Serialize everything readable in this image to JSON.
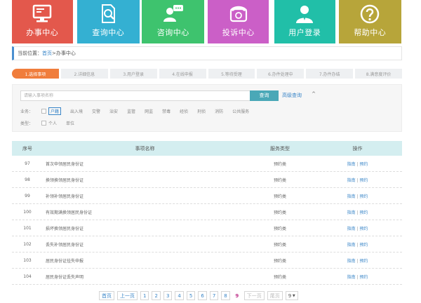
{
  "nav": [
    {
      "label": "办事中心",
      "icon": "monitor-icon"
    },
    {
      "label": "查询中心",
      "icon": "document-search-icon"
    },
    {
      "label": "咨询中心",
      "icon": "chat-user-icon"
    },
    {
      "label": "投诉中心",
      "icon": "telephone-icon"
    },
    {
      "label": "用户登录",
      "icon": "user-icon"
    },
    {
      "label": "帮助中心",
      "icon": "question-icon"
    }
  ],
  "breadcrumb": {
    "prefix": "当前位置：",
    "home": "首页",
    "sep": " > ",
    "current": "办事中心"
  },
  "steps": [
    "1.选择事项",
    "2.详细信息",
    "3.用户登录",
    "4.在线申报",
    "5.等待受理",
    "6.办件处理中",
    "7.办件办结",
    "8.满意度评价"
  ],
  "search": {
    "placeholder": "请输入事项名称",
    "button": "查询",
    "advanced": "高级查询",
    "caret": "^"
  },
  "filters": {
    "category_label": "业务：",
    "category_options": [
      "户籍",
      "出入境",
      "交警",
      "治安",
      "监管",
      "网监",
      "禁毒",
      "经侦",
      "刑侦",
      "消防",
      "公共服务"
    ],
    "type_label": "类型：",
    "type_options": [
      "个人",
      "单位"
    ]
  },
  "table": {
    "headers": [
      "序号",
      "事项名称",
      "服务类型",
      "操作"
    ],
    "rows": [
      {
        "no": "97",
        "name": "首次申领居民身份证",
        "type": "预约类",
        "guide": "指南",
        "book": "预约"
      },
      {
        "no": "98",
        "name": "换领换领居民身份证",
        "type": "预约类",
        "guide": "指南",
        "book": "预约"
      },
      {
        "no": "99",
        "name": "补领补领居民身份证",
        "type": "预约类",
        "guide": "指南",
        "book": "预约"
      },
      {
        "no": "100",
        "name": "有效期满换领居民身份证",
        "type": "预约类",
        "guide": "指南",
        "book": "预约"
      },
      {
        "no": "101",
        "name": "损坏换领居民身份证",
        "type": "预约类",
        "guide": "指南",
        "book": "预约"
      },
      {
        "no": "102",
        "name": "丢失补领居民身份证",
        "type": "预约类",
        "guide": "指南",
        "book": "预约"
      },
      {
        "no": "103",
        "name": "居民身份证挂失申报",
        "type": "预约类",
        "guide": "指南",
        "book": "预约"
      },
      {
        "no": "104",
        "name": "居民身份证丢失声明",
        "type": "预约类",
        "guide": "指南",
        "book": "预约"
      }
    ]
  },
  "pager": {
    "first": "首页",
    "prev": "上一页",
    "pages": [
      "1",
      "2",
      "3",
      "4",
      "5",
      "6",
      "7",
      "8",
      "9"
    ],
    "current": "9",
    "next": "下一页",
    "last": "尾页",
    "select_value": "9"
  }
}
